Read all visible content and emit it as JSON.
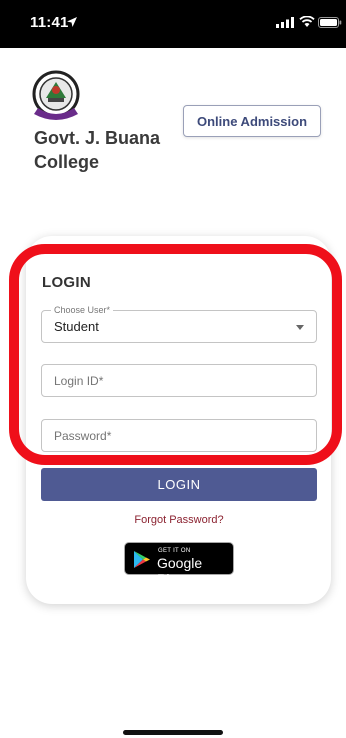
{
  "status_bar": {
    "time": "11:41",
    "icons": [
      "location-arrow-icon",
      "signal-icon",
      "wifi-icon",
      "battery-icon"
    ]
  },
  "header": {
    "college_name": "Govt. J. Buana College",
    "online_admission_label": "Online Admission",
    "logo_icon": "college-crest-icon"
  },
  "login": {
    "title": "LOGIN",
    "choose_user": {
      "legend": "Choose User*",
      "value": "Student"
    },
    "login_id_placeholder": "Login ID*",
    "password_placeholder": "Password*",
    "login_button_label": "LOGIN",
    "forgot_password_label": "Forgot Password?",
    "google_play": {
      "small_text": "GET IT ON",
      "big_text": "Google Play"
    }
  },
  "colors": {
    "primary": "#4f5a93",
    "forgot_link": "#8b2230",
    "highlight": "#ef0f1a"
  }
}
